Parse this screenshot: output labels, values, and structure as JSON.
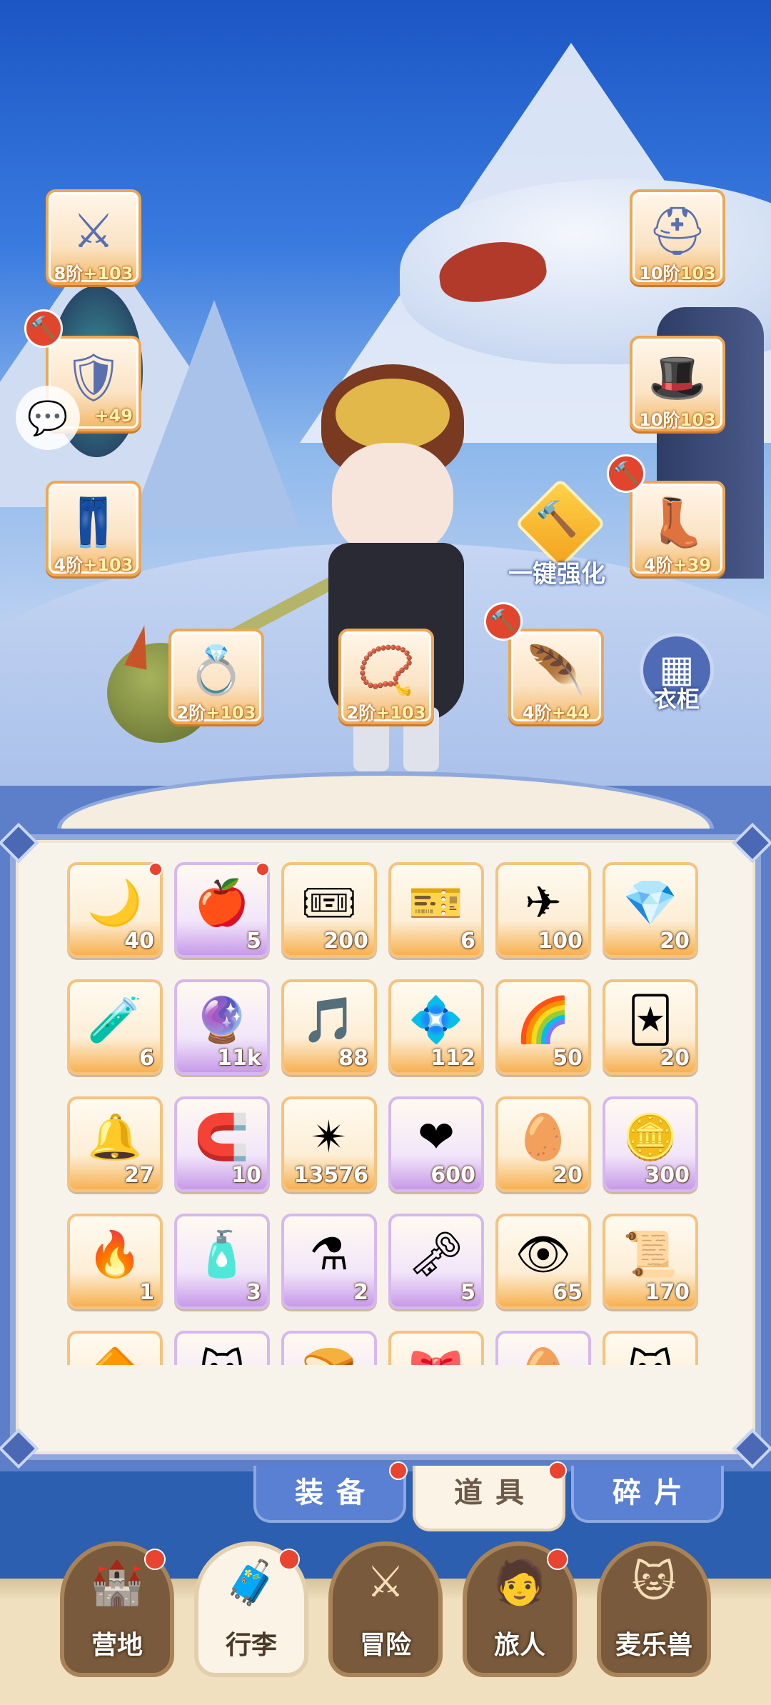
{
  "equipment": {
    "weapon": {
      "glyph": "⚔",
      "tier": "8阶",
      "bonus": "+103"
    },
    "armor": {
      "glyph": "🛡",
      "tier": "",
      "bonus": "+49"
    },
    "pants": {
      "glyph": "👖",
      "tier": "4阶",
      "bonus": "+103"
    },
    "helmet": {
      "glyph": "⛑",
      "tier": "10阶",
      "bonus": "103"
    },
    "hat": {
      "glyph": "🎩",
      "tier": "10阶",
      "bonus": "103"
    },
    "boots": {
      "glyph": "👢",
      "tier": "4阶",
      "bonus": "+39"
    },
    "ring": {
      "glyph": "💍",
      "tier": "2阶",
      "bonus": "+103"
    },
    "necklace": {
      "glyph": "📿",
      "tier": "2阶",
      "bonus": "+103"
    },
    "feather": {
      "glyph": "🪶",
      "tier": "4阶",
      "bonus": "+44"
    }
  },
  "upgrade_all_label": "一键强化",
  "wardrobe_label": "衣柜",
  "chat_glyph": "💬",
  "hammer_glyph": "🔨",
  "inventory": [
    {
      "glyph": "🌙",
      "qty": "40"
    },
    {
      "glyph": "🍎",
      "qty": "5"
    },
    {
      "glyph": "🎟",
      "qty": "200"
    },
    {
      "glyph": "🎫",
      "qty": "6"
    },
    {
      "glyph": "✈",
      "qty": "100"
    },
    {
      "glyph": "💎",
      "qty": "20"
    },
    {
      "glyph": "🧪",
      "qty": "6"
    },
    {
      "glyph": "🔮",
      "qty": "11k"
    },
    {
      "glyph": "🎵",
      "qty": "88"
    },
    {
      "glyph": "💠",
      "qty": "112"
    },
    {
      "glyph": "🌈",
      "qty": "50"
    },
    {
      "glyph": "🃏",
      "qty": "20"
    },
    {
      "glyph": "🔔",
      "qty": "27"
    },
    {
      "glyph": "🧲",
      "qty": "10"
    },
    {
      "glyph": "✴",
      "qty": "13576"
    },
    {
      "glyph": "❤",
      "qty": "600"
    },
    {
      "glyph": "🥚",
      "qty": "20"
    },
    {
      "glyph": "🪙",
      "qty": "300"
    },
    {
      "glyph": "🔥",
      "qty": "1"
    },
    {
      "glyph": "🧴",
      "qty": "3"
    },
    {
      "glyph": "⚗",
      "qty": "2"
    },
    {
      "glyph": "🗝",
      "qty": "5"
    },
    {
      "glyph": "👁",
      "qty": "65"
    },
    {
      "glyph": "📜",
      "qty": "170"
    },
    {
      "glyph": "🔶",
      "qty": ""
    },
    {
      "glyph": "🐱",
      "qty": ""
    },
    {
      "glyph": "🍞",
      "qty": ""
    },
    {
      "glyph": "🎀",
      "qty": ""
    },
    {
      "glyph": "🥚",
      "qty": ""
    },
    {
      "glyph": "🐱",
      "qty": ""
    }
  ],
  "tabs": {
    "equipment": "装备",
    "items": "道具",
    "shards": "碎片"
  },
  "nav": {
    "camp": {
      "glyph": "🏰",
      "label": "营地"
    },
    "bag": {
      "glyph": "🧳",
      "label": "行李"
    },
    "adventure": {
      "glyph": "⚔",
      "label": "冒险"
    },
    "traveler": {
      "glyph": "🧑",
      "label": "旅人"
    },
    "pets": {
      "glyph": "🐱",
      "label": "麦乐兽"
    }
  }
}
